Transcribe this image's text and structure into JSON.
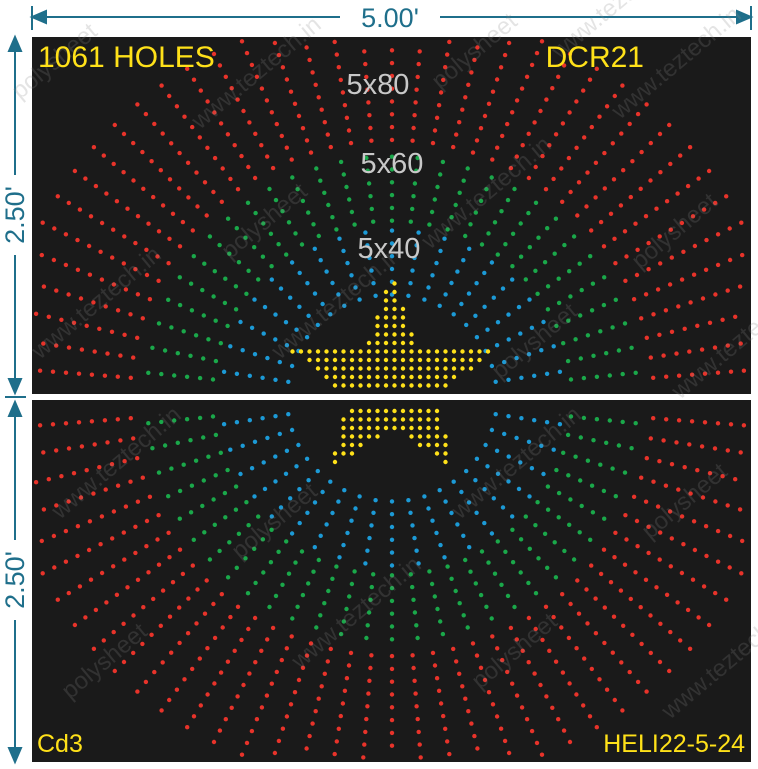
{
  "dimensions": {
    "width_label": "5.00'",
    "upper_height_label": "2.50'",
    "lower_height_label": "2.50'"
  },
  "labels": {
    "hole_count": "1061 HOLES",
    "design_code": "DCR21",
    "bottom_left_code": "Cd3",
    "part_number": "HELI22-5-24"
  },
  "rings": [
    {
      "label": "5x80",
      "color": "#e8332a"
    },
    {
      "label": "5x60",
      "color": "#1aa84a"
    },
    {
      "label": "5x40",
      "color": "#1c9ad6"
    }
  ],
  "star_color": "#ffe119",
  "watermarks": [
    "polysheet",
    "www.teztech.in"
  ],
  "colors": {
    "panel": "#1a1a1a",
    "dimension": "#1f6f8b",
    "label_text": "#ffe119"
  }
}
